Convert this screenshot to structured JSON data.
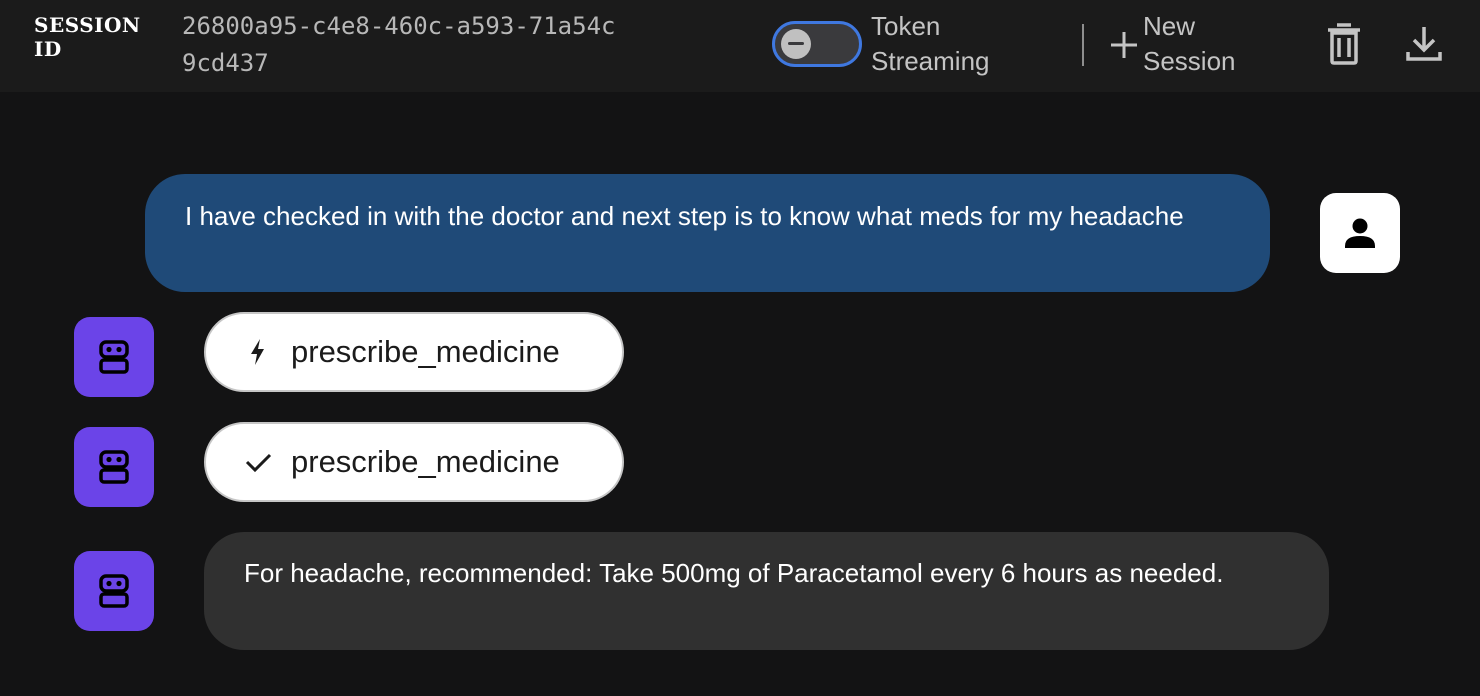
{
  "header": {
    "session_label": "SESSION ID",
    "session_id": "26800a95-c4e8-460c-a593-71a54c9cd437",
    "streaming_toggle": {
      "label": "Token Streaming",
      "state": "off"
    },
    "new_session_label": "New Session",
    "icons": {
      "plus": "plus-icon",
      "trash": "trash-icon",
      "download": "download-icon"
    }
  },
  "conversation": {
    "user_message": "I have checked in with the doctor and next step is to know what meds for my headache",
    "tool_call": {
      "icon": "bolt-icon",
      "name": "prescribe_medicine"
    },
    "tool_response": {
      "icon": "check-icon",
      "name": "prescribe_medicine"
    },
    "bot_message": "For headache, recommended: Take 500mg of Paracetamol every 6 hours as needed."
  },
  "colors": {
    "user_bubble": "#1f4a78",
    "bot_avatar": "#6b44e8",
    "bot_bubble": "#303030",
    "toggle_border": "#3f78e0"
  }
}
